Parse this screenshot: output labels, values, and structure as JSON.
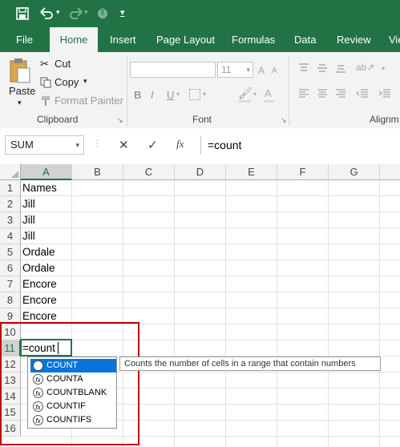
{
  "colors": {
    "brand": "#217346",
    "ribbon": "#f3f3f3",
    "selection": "#0a74da",
    "highlight_box": "#c00000",
    "active_cell_border": "#217346"
  },
  "quick_access": {
    "save_icon": "save-icon",
    "undo_icon": "undo-icon",
    "redo_icon": "redo-icon",
    "touch_icon": "touch-mode-icon",
    "more_icon": "customize-icon"
  },
  "tabs": [
    {
      "label": "File"
    },
    {
      "label": "Home"
    },
    {
      "label": "Insert"
    },
    {
      "label": "Page Layout"
    },
    {
      "label": "Formulas"
    },
    {
      "label": "Data"
    },
    {
      "label": "Review"
    },
    {
      "label": "Vie"
    }
  ],
  "ribbon": {
    "clipboard": {
      "paste": "Paste",
      "cut": "Cut",
      "copy": "Copy",
      "format_painter": "Format Painter",
      "label": "Clipboard"
    },
    "font": {
      "name": "",
      "size": "11",
      "bold": "B",
      "italic": "I",
      "underline": "U",
      "label": "Font"
    },
    "alignment": {
      "label": "Alignm"
    }
  },
  "formula_bar": {
    "name_box": "SUM",
    "cancel": "✕",
    "enter": "✓",
    "fx": "fx",
    "formula": "=count"
  },
  "columns": [
    "A",
    "B",
    "C",
    "D",
    "E",
    "F",
    "G"
  ],
  "rows": [
    "1",
    "2",
    "3",
    "4",
    "5",
    "6",
    "7",
    "8",
    "9",
    "10",
    "11",
    "12",
    "13",
    "14",
    "15",
    "16"
  ],
  "cells": {
    "a1": "Names",
    "a2": "Jill",
    "a3": "Jill",
    "a4": "Jill",
    "a5": "Ordale",
    "a6": "Ordale",
    "a7": "Encore",
    "a8": "Encore",
    "a9": "Encore",
    "a11": "=count"
  },
  "autocomplete": {
    "items": [
      {
        "label": "COUNT"
      },
      {
        "label": "COUNTA"
      },
      {
        "label": "COUNTBLANK"
      },
      {
        "label": "COUNTIF"
      },
      {
        "label": "COUNTIFS"
      }
    ],
    "tooltip": "Counts the number of cells in a range that contain numbers",
    "fx_glyph": "fx"
  }
}
